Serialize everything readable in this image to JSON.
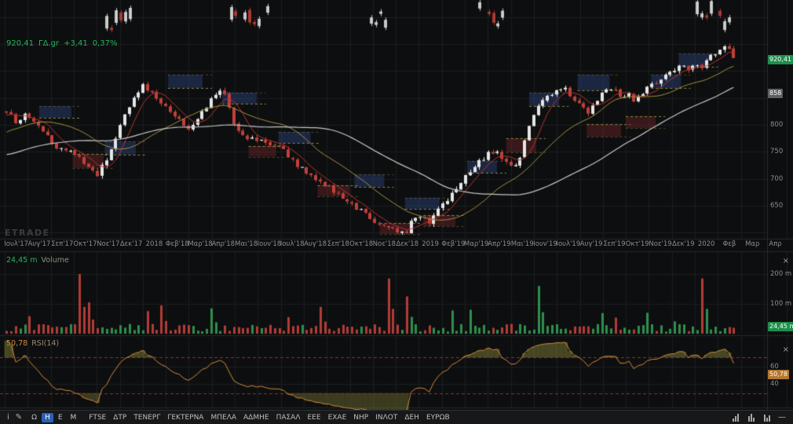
{
  "app": {
    "watermark": "ETRADE"
  },
  "legend": {
    "price": "920,41",
    "symbol": "ΓΔ.gr",
    "change": "+3,41",
    "change_pct": "0,37%"
  },
  "price_axis": {
    "ticks": [
      {
        "label": "800",
        "price": 800
      },
      {
        "label": "750",
        "price": 750
      },
      {
        "label": "700",
        "price": 700
      },
      {
        "label": "650",
        "price": 650
      }
    ],
    "last_price_badge": {
      "label": "920,41",
      "price": 920.41,
      "bg": "#1d8f4c"
    },
    "ma_badge": {
      "label": "858",
      "price": 858,
      "bg": "#606060"
    }
  },
  "time_axis": {
    "labels": [
      "Ιουλ'17",
      "Αυγ'17",
      "Σεπ'17",
      "Οκτ'17",
      "Νοε'17",
      "Δεκ'17",
      "2018",
      "Φεβ'18",
      "Μαρ'18",
      "Απρ'18",
      "Μαι'18",
      "Ιουν'18",
      "Ιουλ'18",
      "Αυγ'18",
      "Σεπ'18",
      "Οκτ'18",
      "Νοε'18",
      "Δεκ'18",
      "2019",
      "Φεβ'19",
      "Μαρ'19",
      "Απρ'19",
      "Μαι'19",
      "Ιουν'19",
      "Ιουλ'19",
      "Αυγ'19",
      "Σεπ'19",
      "Οκτ'19",
      "Νοε'19",
      "Δεκ'19",
      "2020",
      "Φεβ",
      "Μαρ",
      "Απρ"
    ]
  },
  "volume_pane": {
    "value": "24,45 m",
    "label": "Volume",
    "close_glyph": "×",
    "ticks": [
      {
        "label": "200 m",
        "value": 200
      },
      {
        "label": "100 m",
        "value": 100
      }
    ],
    "badge": {
      "label": "24,45 m",
      "value": 24.45,
      "bg": "#1d8f4c"
    }
  },
  "rsi_pane": {
    "value": "50,78",
    "label": "RSI(14)",
    "close_glyph": "×",
    "ticks": [
      {
        "label": "60",
        "value": 60
      },
      {
        "label": "40",
        "value": 40
      }
    ],
    "badge": {
      "label": "50,78",
      "value": 50.78,
      "bg": "#b5762f"
    }
  },
  "toolbar": {
    "tools": [
      {
        "name": "info-icon",
        "glyph": "i"
      },
      {
        "name": "pencil-icon",
        "glyph": "✎"
      }
    ],
    "timeframes": [
      {
        "label": "Ω",
        "active": false
      },
      {
        "label": "Η",
        "active": true
      },
      {
        "label": "Ε",
        "active": false
      },
      {
        "label": "Μ",
        "active": false
      }
    ],
    "symbols": [
      "FTSE",
      "ΔΤΡ",
      "ΤΕΝΕΡΓ",
      "ΓΕΚΤΕΡΝΑ",
      "ΜΠΕΛΑ",
      "ΑΔΜΗΕ",
      "ΠΑΣΑΛ",
      "ΕΕΕ",
      "ΕΧΑΕ",
      "ΝΗΡ",
      "ΙΝΛΟΤ",
      "ΔΕΗ",
      "ΕΥΡΩΒ"
    ],
    "right_icons": [
      {
        "name": "volume-bars-icon",
        "type": "bars",
        "heights": [
          4,
          7,
          10
        ]
      },
      {
        "name": "histogram-icon",
        "type": "bars",
        "heights": [
          7,
          10,
          5
        ]
      },
      {
        "name": "candles-style-icon",
        "type": "bars",
        "heights": [
          9,
          5,
          8
        ]
      },
      {
        "name": "collapse-icon",
        "type": "glyph",
        "glyph": "—"
      }
    ]
  },
  "chart_data": {
    "type": "candlestick",
    "symbol": "ΓΔ.gr",
    "timeframe": "daily",
    "last": 920.41,
    "change": 3.41,
    "change_pct": 0.37,
    "ylim_visible": [
      587,
      1032
    ],
    "prehistory_anchors": [
      [
        -9,
        690
      ],
      [
        -6,
        715
      ],
      [
        -4,
        742
      ],
      [
        -2,
        778
      ],
      [
        -1,
        805
      ],
      [
        0,
        828
      ]
    ],
    "price_anchors": [
      [
        0,
        828
      ],
      [
        0.5,
        806
      ],
      [
        1,
        820
      ],
      [
        1.6,
        793
      ],
      [
        2,
        768
      ],
      [
        2.5,
        752
      ],
      [
        3,
        750
      ],
      [
        3.5,
        726
      ],
      [
        4,
        706
      ],
      [
        4.5,
        740
      ],
      [
        5,
        798
      ],
      [
        5.6,
        846
      ],
      [
        6,
        872
      ],
      [
        6.5,
        856
      ],
      [
        7,
        832
      ],
      [
        7.5,
        812
      ],
      [
        8,
        790
      ],
      [
        8.5,
        818
      ],
      [
        9.2,
        858
      ],
      [
        9.5,
        862
      ],
      [
        10,
        800
      ],
      [
        10.5,
        778
      ],
      [
        11,
        772
      ],
      [
        11.5,
        762
      ],
      [
        12,
        757
      ],
      [
        12.5,
        736
      ],
      [
        13,
        714
      ],
      [
        13.5,
        700
      ],
      [
        14,
        688
      ],
      [
        14.5,
        668
      ],
      [
        15,
        653
      ],
      [
        15.5,
        640
      ],
      [
        16,
        624
      ],
      [
        16.5,
        613
      ],
      [
        17,
        601
      ],
      [
        17.4,
        597
      ],
      [
        17.7,
        621
      ],
      [
        18,
        634
      ],
      [
        18.4,
        618
      ],
      [
        18.8,
        642
      ],
      [
        19.2,
        658
      ],
      [
        19.6,
        682
      ],
      [
        20,
        704
      ],
      [
        20.5,
        727
      ],
      [
        21,
        746
      ],
      [
        21.4,
        751
      ],
      [
        21.8,
        729
      ],
      [
        22.1,
        723
      ],
      [
        22.4,
        738
      ],
      [
        22.7,
        788
      ],
      [
        23,
        822
      ],
      [
        23.5,
        849
      ],
      [
        24,
        866
      ],
      [
        24.3,
        871
      ],
      [
        24.7,
        846
      ],
      [
        25,
        838
      ],
      [
        25.4,
        821
      ],
      [
        25.8,
        849
      ],
      [
        26.1,
        862
      ],
      [
        26.4,
        867
      ],
      [
        26.8,
        851
      ],
      [
        27.1,
        856
      ],
      [
        27.4,
        843
      ],
      [
        27.8,
        861
      ],
      [
        28.2,
        877
      ],
      [
        28.6,
        889
      ],
      [
        29,
        901
      ],
      [
        29.4,
        911
      ],
      [
        29.7,
        899
      ],
      [
        30,
        916
      ],
      [
        30.3,
        906
      ],
      [
        30.7,
        929
      ],
      [
        31.1,
        941
      ],
      [
        31.45,
        951
      ],
      [
        31.6,
        920.41
      ]
    ],
    "overlays": [
      {
        "name": "ma-fast",
        "window": 6,
        "color": "#b5342e",
        "width": 1
      },
      {
        "name": "ma-medium",
        "window": 20,
        "color": "#a08f3f",
        "width": 1
      },
      {
        "name": "ma-slow",
        "window": 48,
        "color": "#c6c6c6",
        "width": 1.2
      }
    ],
    "supply_zones": [
      [
        1.5,
        2.9,
        813,
        835
      ],
      [
        4.35,
        5.7,
        745,
        769
      ],
      [
        7.1,
        8.6,
        868,
        893
      ],
      [
        9.45,
        10.95,
        839,
        860
      ],
      [
        11.9,
        13.3,
        766,
        787
      ],
      [
        15.2,
        16.5,
        685,
        708
      ],
      [
        17.4,
        18.9,
        644,
        665
      ],
      [
        20.1,
        21.4,
        711,
        733
      ],
      [
        22.8,
        24.1,
        835,
        860
      ],
      [
        24.9,
        26.3,
        864,
        893
      ],
      [
        28.1,
        29.4,
        868,
        893
      ],
      [
        29.3,
        30.6,
        908,
        932
      ]
    ],
    "demand_zones": [
      [
        2.95,
        4.3,
        720,
        746
      ],
      [
        10.6,
        11.8,
        741,
        761
      ],
      [
        13.6,
        15.0,
        668,
        688
      ],
      [
        16.3,
        17.7,
        598,
        618
      ],
      [
        18.2,
        19.6,
        612,
        633
      ],
      [
        21.8,
        23.1,
        749,
        775
      ],
      [
        25.3,
        26.8,
        778,
        801
      ],
      [
        27.0,
        28.3,
        794,
        816
      ]
    ],
    "top_clusters": [
      [
        4.45,
        5.5,
        972,
        1028
      ],
      [
        9.85,
        11.45,
        975,
        1022
      ],
      [
        15.95,
        16.7,
        978,
        1015
      ],
      [
        20.45,
        21.75,
        972,
        1028
      ],
      [
        29.9,
        31.55,
        968,
        1032
      ]
    ],
    "volume": {
      "unit": "m",
      "current": 24.45,
      "gridlines": [
        100,
        200
      ],
      "spikes": [
        [
          0.1,
          200
        ],
        [
          0.115,
          105
        ],
        [
          0.21,
          95
        ],
        [
          0.28,
          85
        ],
        [
          0.43,
          90
        ],
        [
          0.525,
          185
        ],
        [
          0.55,
          125
        ],
        [
          0.73,
          160
        ],
        [
          0.88,
          70
        ],
        [
          0.955,
          185
        ]
      ]
    },
    "rsi": {
      "period": 14,
      "current": 50.78,
      "overbought": 70,
      "oversold": 30
    }
  }
}
